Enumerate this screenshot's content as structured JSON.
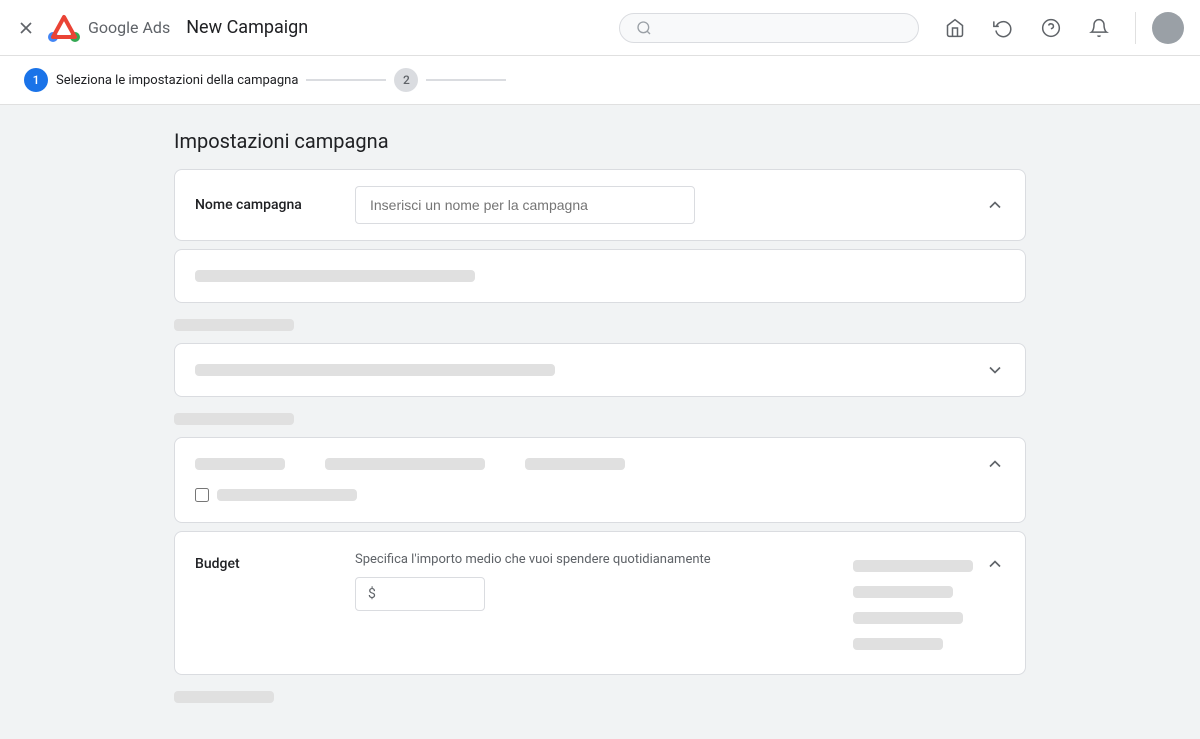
{
  "header": {
    "close_label": "×",
    "brand": "Google Ads",
    "title": "New Campaign",
    "search_placeholder": "",
    "icons": {
      "store": "🏪",
      "history": "↺",
      "help": "?",
      "bell": "🔔"
    }
  },
  "stepper": {
    "step1": {
      "number": "1",
      "label": "Seleziona le impostazioni della campagna",
      "active": true
    },
    "step2": {
      "number": "2",
      "label": "",
      "active": false
    }
  },
  "main": {
    "section_title": "Impostazioni campagna",
    "campaign_name": {
      "label": "Nome campagna",
      "placeholder": "Inserisci un nome per la campagna"
    },
    "budget": {
      "label": "Budget",
      "description": "Specifica l'importo medio che vuoi spendere quotidianamente",
      "currency_symbol": "$",
      "input_value": ""
    }
  }
}
